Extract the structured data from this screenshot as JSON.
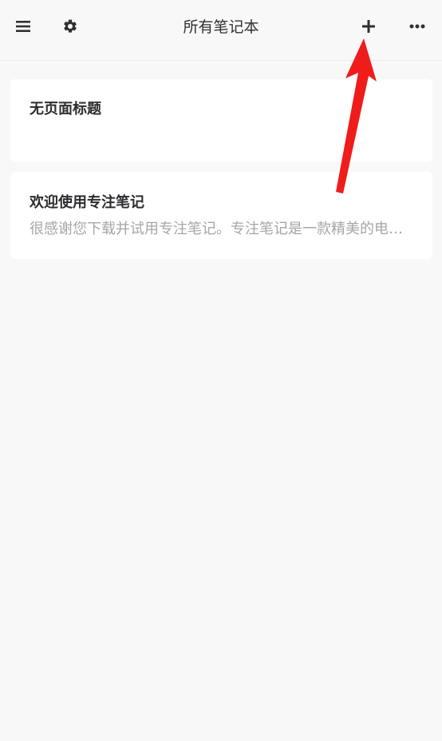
{
  "header": {
    "title": "所有笔记本",
    "icons": {
      "menu": "menu-icon",
      "settings": "gear-icon",
      "add": "plus-icon",
      "more": "more-icon"
    }
  },
  "notes": [
    {
      "title": "无页面标题",
      "preview": ""
    },
    {
      "title": "欢迎使用专注笔记",
      "preview": "很感谢您下载并试用专注笔记。专注笔记是一款精美的电子笔记应用"
    }
  ],
  "colors": {
    "background": "#f8f8f9",
    "card": "#ffffff",
    "icon": "#2f3133",
    "annotation_arrow": "#f01c1c"
  }
}
